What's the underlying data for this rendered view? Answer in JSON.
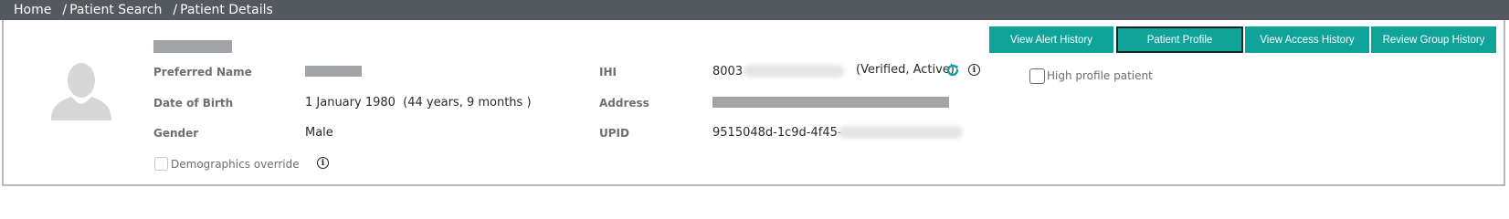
{
  "breadcrumb": {
    "items": [
      "Home",
      "Patient Search",
      "Patient Details"
    ],
    "separator": "/"
  },
  "patient": {
    "preferred_name_label": "Preferred Name",
    "dob_label": "Date of Birth",
    "dob_value": "1 January 1980  (44 years, 9 months )",
    "gender_label": "Gender",
    "gender_value": "Male",
    "demographics_override_label": "Demographics override",
    "ihi_label": "IHI",
    "ihi_prefix": "8003",
    "ihi_status": "(Verified, Active)",
    "address_label": "Address",
    "upid_label": "UPID",
    "upid_prefix": "9515048d-1c9d-4f45-"
  },
  "actions": {
    "view_alert_history": "View Alert History",
    "patient_profile": "Patient Profile",
    "view_access_history": "View Access History",
    "review_group_history": "Review Group History",
    "high_profile_label": "High profile patient"
  },
  "colors": {
    "topbar": "#54595f",
    "button": "#10a39a",
    "active_border": "#12262a",
    "redaction": "#a3a4a8",
    "label": "#6e6e6e"
  },
  "icons": {
    "avatar": "person-silhouette-icon",
    "refresh": "refresh-icon",
    "info": "info-icon"
  }
}
